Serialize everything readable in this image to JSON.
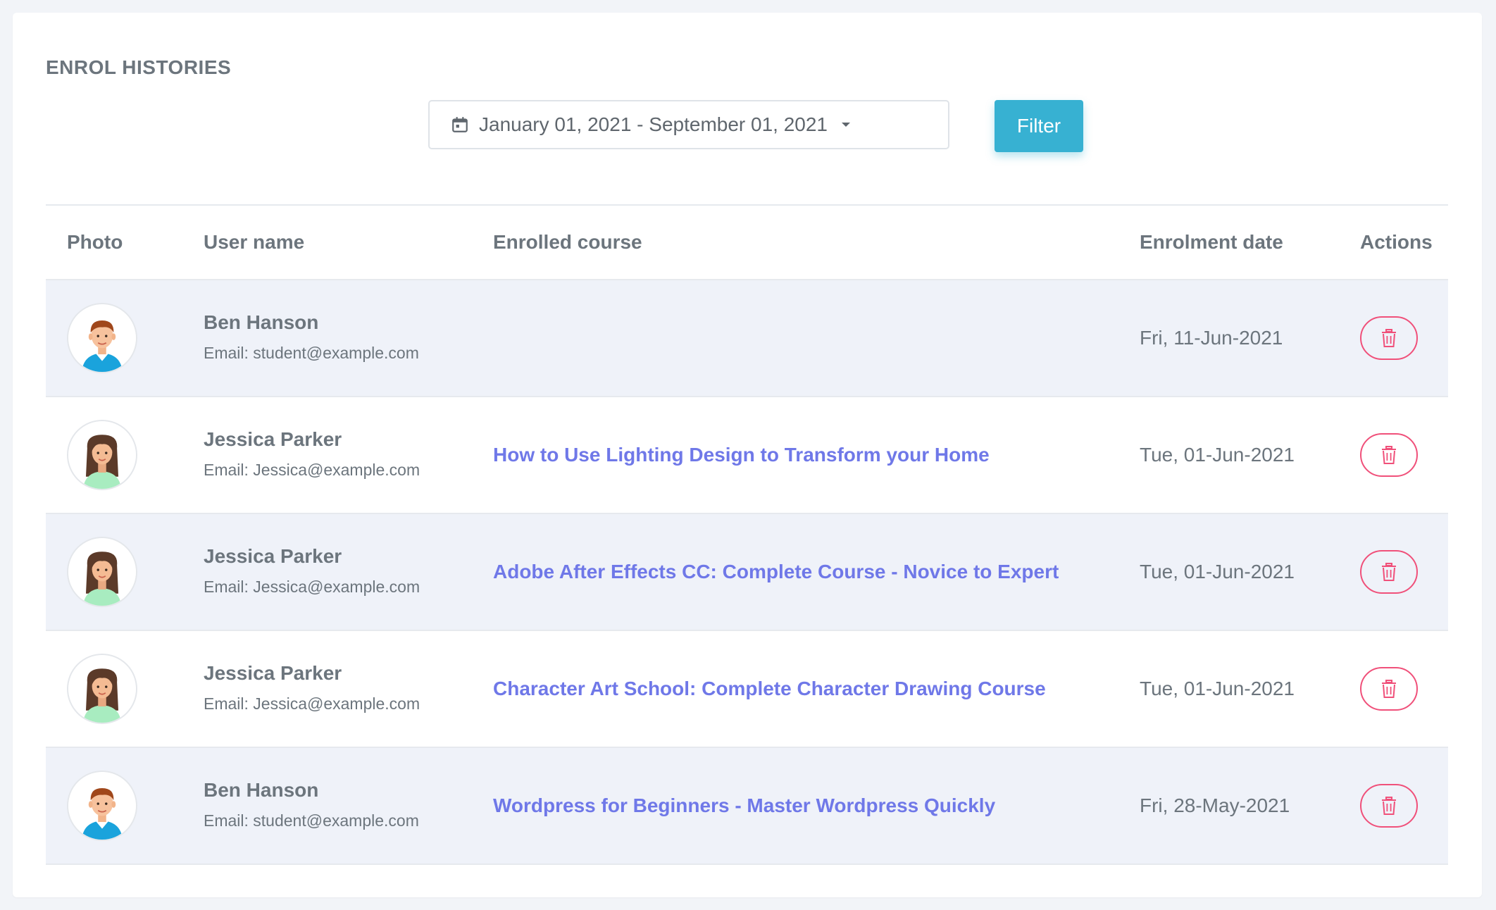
{
  "page": {
    "title": "ENROL HISTORIES"
  },
  "filter": {
    "date_range": "January 01, 2021 - September 01, 2021",
    "button_label": "Filter"
  },
  "table": {
    "columns": [
      "Photo",
      "User name",
      "Enrolled course",
      "Enrolment date",
      "Actions"
    ],
    "rows": [
      {
        "avatar": "male-avatar",
        "name": "Ben Hanson",
        "email": "Email: student@example.com",
        "course": "",
        "date": "Fri, 11-Jun-2021"
      },
      {
        "avatar": "female-avatar",
        "name": "Jessica Parker",
        "email": "Email: Jessica@example.com",
        "course": "How to Use Lighting Design to Transform your Home",
        "date": "Tue, 01-Jun-2021"
      },
      {
        "avatar": "female-avatar",
        "name": "Jessica Parker",
        "email": "Email: Jessica@example.com",
        "course": "Adobe After Effects CC: Complete Course - Novice to Expert",
        "date": "Tue, 01-Jun-2021"
      },
      {
        "avatar": "female-avatar",
        "name": "Jessica Parker",
        "email": "Email: Jessica@example.com",
        "course": "Character Art School: Complete Character Drawing Course",
        "date": "Tue, 01-Jun-2021"
      },
      {
        "avatar": "male-avatar",
        "name": "Ben Hanson",
        "email": "Email: student@example.com",
        "course": "Wordpress for Beginners - Master Wordpress Quickly",
        "date": "Fri, 28-May-2021"
      }
    ],
    "action_icon": "trash-icon"
  },
  "colors": {
    "accent": "#37b1d2",
    "link": "#6f78e8",
    "danger": "#f0507a",
    "row_alt": "#eff2f9"
  }
}
